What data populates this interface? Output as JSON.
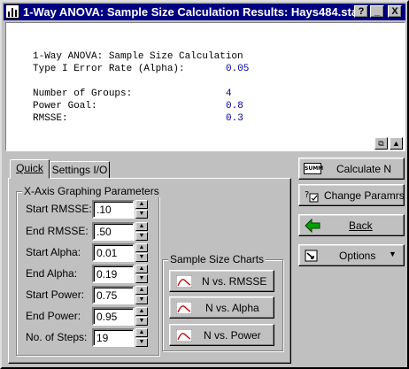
{
  "window": {
    "title": "1-Way ANOVA: Sample Size Calculation Results: Hays484.sta",
    "help_label": "?",
    "minimize_label": "_",
    "close_label": "X"
  },
  "results": {
    "heading": "1-Way ANOVA: Sample Size Calculation",
    "rows1": [
      {
        "label": "Type I Error Rate (Alpha):",
        "value": "0.05"
      }
    ],
    "rows2": [
      {
        "label": "Number of Groups:",
        "value": "4"
      },
      {
        "label": "Power Goal:",
        "value": "0.8"
      },
      {
        "label": "RMSSE:",
        "value": "0.3"
      }
    ],
    "copy_glyph": "⧉",
    "scroll_glyph": "▲"
  },
  "tabs": [
    {
      "label": "Quick",
      "selected": true
    },
    {
      "label": "Settings I/O",
      "selected": false
    }
  ],
  "x_axis_group": {
    "title": "X-Axis Graphing Parameters",
    "fields": [
      {
        "label": "Start RMSSE:",
        "value": ".10"
      },
      {
        "label": "End RMSSE:",
        "value": ".50"
      },
      {
        "label": "Start Alpha:",
        "value": "0.01"
      },
      {
        "label": "End Alpha:",
        "value": "0.19"
      },
      {
        "label": "Start Power:",
        "value": "0.75"
      },
      {
        "label": "End Power:",
        "value": "0.95"
      },
      {
        "label": "No. of Steps:",
        "value": "19"
      }
    ],
    "spin_up": "▲",
    "spin_down": "▼"
  },
  "sample_size_group": {
    "title": "Sample Size Charts",
    "buttons": [
      {
        "label": "N vs. RMSSE"
      },
      {
        "label": "N vs. Alpha"
      },
      {
        "label": "N vs. Power"
      }
    ]
  },
  "actions": {
    "calculate_label": "Calculate N",
    "calculate_icon_text": "SUMM",
    "change_label": "Change Paramrs",
    "back_label": "Back",
    "options_label": "Options",
    "options_arrow": "▼"
  },
  "colors": {
    "title_bar": "#000080",
    "value_text": "#0000a0",
    "back_arrow": "#00a000",
    "chart_curve": "#c00000"
  }
}
